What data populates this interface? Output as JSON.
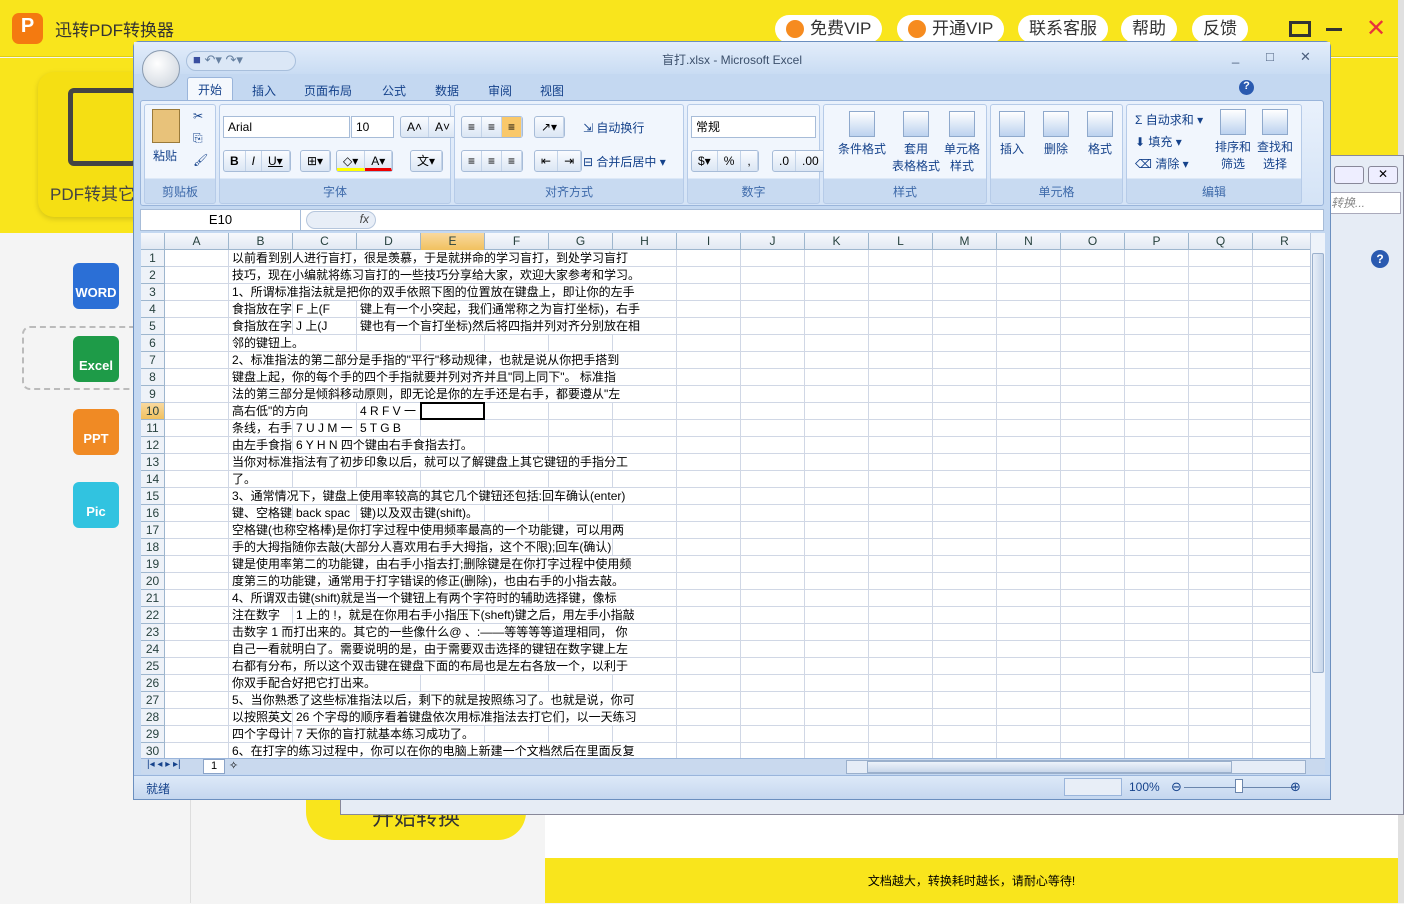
{
  "app": {
    "title": "迅转PDF转换器",
    "logo_text": "P",
    "header_buttons": [
      "免费VIP",
      "开通VIP",
      "联系客服",
      "帮助",
      "反馈"
    ],
    "card_label": "PDF转其它",
    "side_items": [
      "WORD",
      "Excel",
      "PPT",
      "Pic"
    ],
    "start_button": "开始转换",
    "footer_tip": "文档越大，转换耗时越长，请耐心等待!",
    "search_placeholder": "转换..."
  },
  "excel": {
    "title": "盲打.xlsx - Microsoft Excel",
    "tabs": [
      "开始",
      "插入",
      "页面布局",
      "公式",
      "数据",
      "审阅",
      "视图"
    ],
    "groups": {
      "clipboard": {
        "label": "剪贴板",
        "paste": "粘贴"
      },
      "font": {
        "label": "字体",
        "font_name": "Arial",
        "font_size": "10"
      },
      "alignment": {
        "label": "对齐方式",
        "wrap": "自动换行",
        "merge": "合并后居中"
      },
      "number": {
        "label": "数字",
        "format": "常规",
        "percent": "%",
        "comma": ","
      },
      "styles": {
        "label": "样式",
        "cond": "条件格式",
        "table": "套用\n表格格式",
        "cell": "单元格\n样式"
      },
      "cells": {
        "label": "单元格",
        "insert": "插入",
        "delete": "删除",
        "format": "格式"
      },
      "editing": {
        "label": "编辑",
        "autosum": "自动求和",
        "fill": "填充",
        "clear": "清除",
        "sort": "排序和\n筛选",
        "find": "查找和\n选择"
      }
    },
    "name_box": "E10",
    "fx": "fx",
    "columns": [
      "A",
      "B",
      "C",
      "D",
      "E",
      "F",
      "G",
      "H",
      "I",
      "J",
      "K",
      "L",
      "M",
      "N",
      "O",
      "P",
      "Q",
      "R"
    ],
    "selected_column": "E",
    "selected_row": 10,
    "rows": [
      [
        [
          "B",
          "以前看到别人进行盲打，很是羡慕，于是就拼命的学习盲打，到处学习盲打"
        ]
      ],
      [
        [
          "B",
          "技巧，现在小编就将练习盲打的一些技巧分享给大家，欢迎大家参考和学习。"
        ]
      ],
      [
        [
          "B",
          "1、所谓标准指法就是把你的双手依照下图的位置放在键盘上，即让你的左手"
        ]
      ],
      [
        [
          "B",
          "食指放在字母"
        ],
        [
          "C",
          "F 上(F"
        ],
        [
          "D",
          "键上有一个小突起，我们通常称之为盲打坐标)，右手"
        ]
      ],
      [
        [
          "B",
          "食指放在字母"
        ],
        [
          "C",
          "J 上(J"
        ],
        [
          "D",
          "键也有一个盲打坐标)然后将四指并列对齐分别放在相"
        ]
      ],
      [
        [
          "B",
          "邻的键钮上。"
        ]
      ],
      [
        [
          "B",
          "2、标准指法的第二部分是手指的\"平行\"移动规律，也就是说从你把手搭到"
        ]
      ],
      [
        [
          "B",
          "键盘上起，你的每个手的四个手指就要并列对齐并且\"同上同下\"。 标准指"
        ]
      ],
      [
        [
          "B",
          "法的第三部分是倾斜移动原则，即无论是你的左手还是右手，都要遵从\"左"
        ]
      ],
      [
        [
          "B",
          "高右低\"的方向"
        ],
        [
          "D",
          "4 R F V 一"
        ]
      ],
      [
        [
          "B",
          "条线，右手"
        ],
        [
          "C",
          "7 U J M 一"
        ],
        [
          "D",
          "5 T G B"
        ]
      ],
      [
        [
          "B",
          "由左手食指"
        ],
        [
          "C",
          "6 Y H N 四个键由右手食指去打。"
        ]
      ],
      [
        [
          "B",
          "当你对标准指法有了初步印象以后，就可以了解键盘上其它键钮的手指分工"
        ]
      ],
      [
        [
          "B",
          "了。"
        ]
      ],
      [
        [
          "B",
          "3、通常情况下，键盘上使用率较高的其它几个键钮还包括:回车确认(enter)"
        ]
      ],
      [
        [
          "B",
          "键、空格键("
        ],
        [
          "C",
          "back spac"
        ],
        [
          "D",
          "键)以及双击键(shift)。"
        ]
      ],
      [
        [
          "B",
          "空格键(也称空格棒)是你打字过程中使用频率最高的一个功能键，可以用两"
        ]
      ],
      [
        [
          "B",
          "手的大拇指随你去敲(大部分人喜欢用右手大拇指，这个不限);回车(确认)"
        ]
      ],
      [
        [
          "B",
          "键是使用率第二的功能键，由右手小指去打;删除键是在你打字过程中使用频"
        ]
      ],
      [
        [
          "B",
          "度第三的功能键，通常用于打字错误的修正(删除)，也由右手的小指去敲。"
        ]
      ],
      [
        [
          "B",
          "4、所谓双击键(shift)就是当一个键钮上有两个字符时的辅助选择键，像标"
        ]
      ],
      [
        [
          "B",
          "注在数字"
        ],
        [
          "C",
          "1 上的 !，就是在你用右手小指压下(sheft)键之后，用左手小指敲"
        ]
      ],
      [
        [
          "B",
          "击数字 1 而打出来的。其它的一些像什么@ 、:——等等等等道理相同， 你"
        ]
      ],
      [
        [
          "B",
          "自己一看就明白了。需要说明的是，由于需要双击选择的键钮在数字键上左"
        ]
      ],
      [
        [
          "B",
          "右都有分布，所以这个双击键在键盘下面的布局也是左右各放一个，以利于"
        ]
      ],
      [
        [
          "B",
          "你双手配合好把它打出来。"
        ]
      ],
      [
        [
          "B",
          "5、当你熟悉了这些标准指法以后，剩下的就是按照练习了。也就是说，你可"
        ]
      ],
      [
        [
          "B",
          "以按照英文"
        ],
        [
          "C",
          "26 个字母的顺序看着键盘依次用标准指法去打它们，以一天练习"
        ]
      ],
      [
        [
          "B",
          "四个字母计"
        ],
        [
          "C",
          "7 天你的盲打就基本练习成功了。"
        ]
      ],
      [
        [
          "B",
          "6、在打字的练习过程中，你可以在你的电脑上新建一个文档然后在里面反复"
        ]
      ]
    ],
    "sheet_tab": "1",
    "status": "就绪",
    "zoom": "100%",
    "zoom_percent": 100
  }
}
